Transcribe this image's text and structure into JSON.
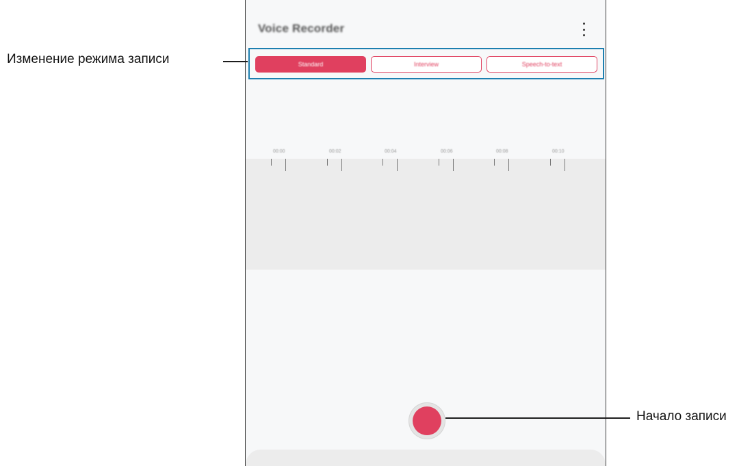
{
  "app": {
    "title": "Voice Recorder",
    "more_icon": "more-vertical-icon"
  },
  "modes": {
    "selected": "Standard",
    "tabs": [
      {
        "label": "Standard"
      },
      {
        "label": "Interview"
      },
      {
        "label": "Speech-to-text"
      }
    ]
  },
  "timeline": {
    "labels": [
      "00:00",
      "00:02",
      "00:04",
      "00:06",
      "00:08",
      "00:10"
    ]
  },
  "annotations": {
    "mode_change": "Изменение режима записи",
    "start_recording": "Начало записи"
  },
  "colors": {
    "accent": "#e0405f",
    "highlight_frame": "#1d7fb0"
  }
}
